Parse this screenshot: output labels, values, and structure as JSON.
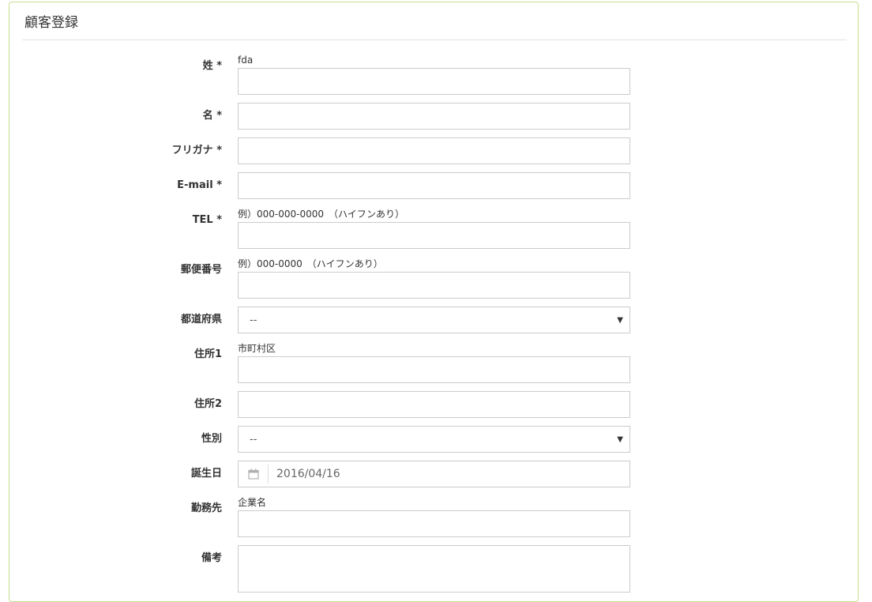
{
  "panel": {
    "title": "顧客登録"
  },
  "fields": [
    {
      "label": "姓 *",
      "hint": "fda",
      "value": ""
    },
    {
      "label": "名 *",
      "value": ""
    },
    {
      "label": "フリガナ *",
      "value": ""
    },
    {
      "label": "E-mail *",
      "value": ""
    },
    {
      "label": "TEL *",
      "hint": "例）000-000-0000　（ハイフンあり）",
      "value": ""
    },
    {
      "label": "郵便番号",
      "hint": "例）000-0000　（ハイフンあり）",
      "value": ""
    },
    {
      "label": "都道府県",
      "selected": "--"
    },
    {
      "label": "住所1",
      "hint": "市町村区",
      "value": ""
    },
    {
      "label": "住所2",
      "value": ""
    },
    {
      "label": "性別",
      "selected": "--"
    },
    {
      "label": "誕生日",
      "value": "2016/04/16",
      "icon": "calendar-icon"
    },
    {
      "label": "勤務先",
      "hint": "企業名",
      "value": ""
    },
    {
      "label": "備考",
      "value": ""
    }
  ]
}
